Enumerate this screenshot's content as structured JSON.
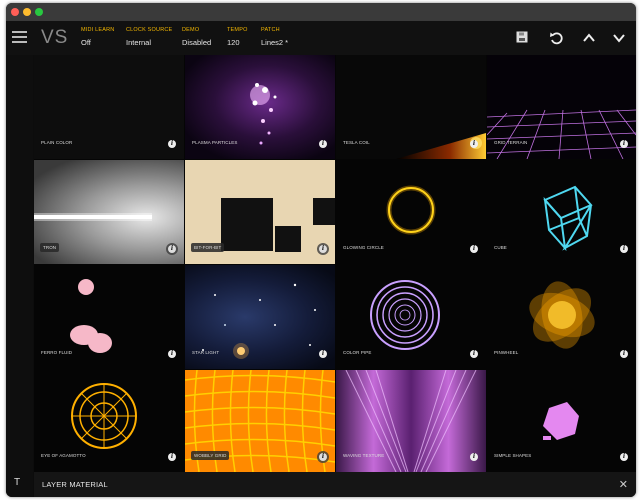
{
  "header": {
    "logo": "VS",
    "fields": [
      {
        "label": "MIDI LEARN",
        "value": "Off"
      },
      {
        "label": "CLOCK SOURCE",
        "value": "Internal"
      },
      {
        "label": "DEMO",
        "value": "Disabled"
      },
      {
        "label": "TEMPO",
        "value": "120"
      },
      {
        "label": "PATCH",
        "value": "Lines2 *"
      }
    ],
    "icons": [
      "save-icon",
      "undo-icon",
      "chevron-up-icon",
      "chevron-down-icon"
    ]
  },
  "sidebar": {
    "bottom_button": "T"
  },
  "tiles": [
    {
      "label": "PLAIN COLOR"
    },
    {
      "label": "PLASMA PARTICLES"
    },
    {
      "label": "TESLA COIL"
    },
    {
      "label": "GRID TERRAIN"
    },
    {
      "label": "TRON"
    },
    {
      "label": "BIT-FOR-BIT"
    },
    {
      "label": "GLOWING CIRCLE"
    },
    {
      "label": "CUBE"
    },
    {
      "label": "FERRO FLUID"
    },
    {
      "label": "STAR LIGHT"
    },
    {
      "label": "COLOR PIPE"
    },
    {
      "label": "PINWHEEL"
    },
    {
      "label": "EYE OF AGAMOTTO"
    },
    {
      "label": "WOBBLY GRID"
    },
    {
      "label": "WAVING TEXTURE"
    },
    {
      "label": "SIMPLE SHAPES"
    }
  ],
  "info_glyph": "i",
  "footer": {
    "title": "LAYER MATERIAL",
    "close": "✕"
  },
  "colors": {
    "accent": "#f2b600",
    "background": "#0c0c0c"
  }
}
